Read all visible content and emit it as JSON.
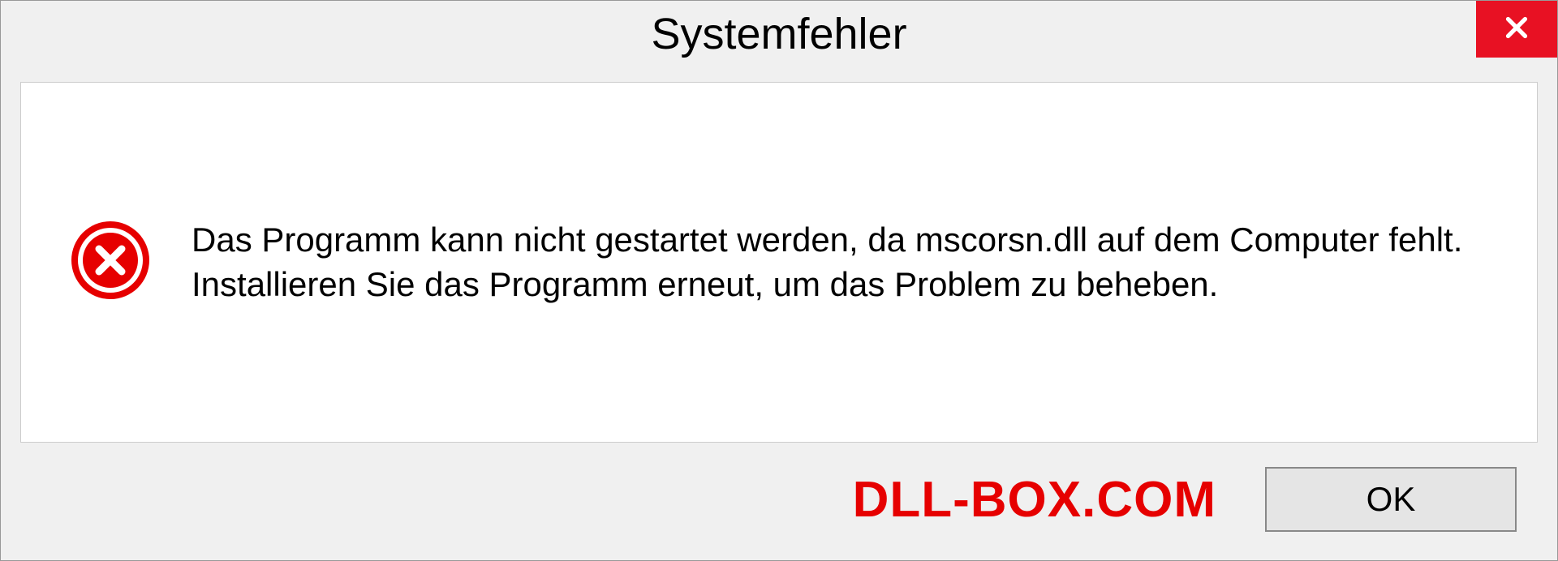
{
  "dialog": {
    "title": "Systemfehler",
    "message": "Das Programm kann nicht gestartet werden, da mscorsn.dll auf dem Computer fehlt. Installieren Sie das Programm erneut, um das Problem zu beheben.",
    "ok_label": "OK"
  },
  "watermark": "DLL-BOX.COM",
  "colors": {
    "close_bg": "#e81123",
    "error_icon": "#e60000",
    "watermark": "#e60000"
  }
}
